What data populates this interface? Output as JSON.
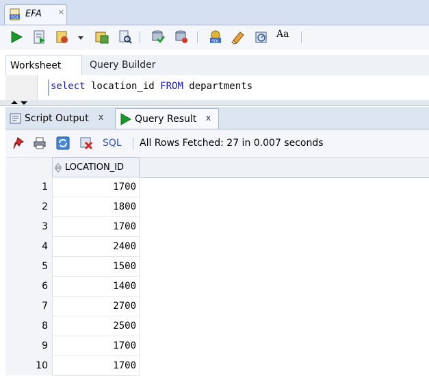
{
  "doc_tab": {
    "title": "EFA",
    "close": "×",
    "icon": "sql-worksheet-icon"
  },
  "toolbar": {
    "buttons": [
      "run-statement-icon",
      "run-script-icon",
      "commit-icon",
      "dropdown-icon",
      "autotrace-icon",
      "explain-plan-icon",
      "rollback-icon",
      "sql-tuning-icon",
      "sql-history-icon",
      "clear-icon",
      "monitor-icon",
      "format-text-icon"
    ],
    "format_label": "Aa"
  },
  "worksheet_tabs": {
    "worksheet": "Worksheet",
    "query_builder": "Query Builder"
  },
  "editor": {
    "kw1": "select",
    "mid": " location_id ",
    "kw2": "FROM",
    "tail": " departments"
  },
  "output_tabs": {
    "script_output": "Script Output",
    "query_result": "Query Result",
    "close": "x"
  },
  "result_toolbar": {
    "sql_label": "SQL",
    "status": "All Rows Fetched: 27 in 0.007 seconds"
  },
  "grid": {
    "column": "LOCATION_ID",
    "rows": [
      {
        "num": "1",
        "value": "1700"
      },
      {
        "num": "2",
        "value": "1800"
      },
      {
        "num": "3",
        "value": "1700"
      },
      {
        "num": "4",
        "value": "2400"
      },
      {
        "num": "5",
        "value": "1500"
      },
      {
        "num": "6",
        "value": "1400"
      },
      {
        "num": "7",
        "value": "2700"
      },
      {
        "num": "8",
        "value": "2500"
      },
      {
        "num": "9",
        "value": "1700"
      },
      {
        "num": "10",
        "value": "1700"
      }
    ]
  },
  "colors": {
    "accent": "#2a55b8",
    "run_green": "#1a9a2a",
    "keyword": "#1a1ab0"
  }
}
